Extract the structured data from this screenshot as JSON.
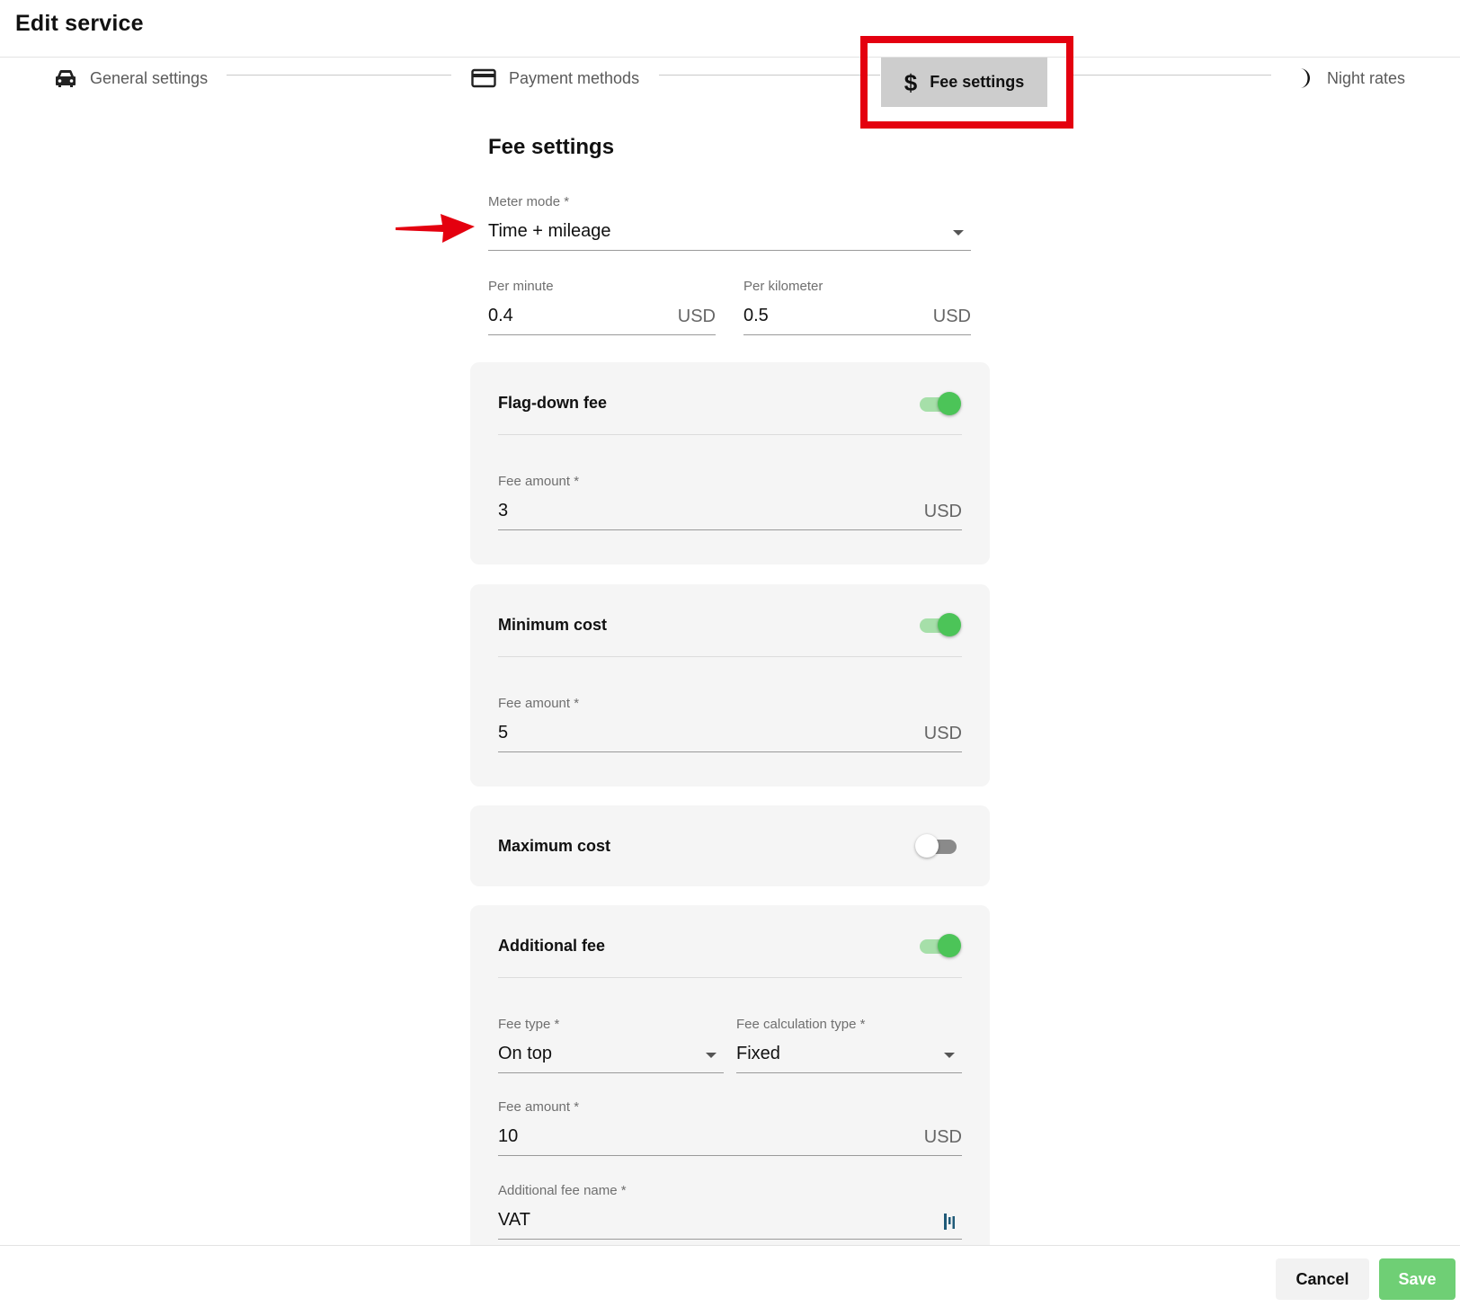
{
  "header": {
    "title": "Edit service"
  },
  "stepper": {
    "steps": [
      {
        "label": "General settings",
        "icon": "car-icon"
      },
      {
        "label": "Payment methods",
        "icon": "credit-card-icon"
      },
      {
        "label": "Fee settings",
        "icon": "dollar-icon",
        "active": true
      },
      {
        "label": "Night rates",
        "icon": "moon-icon"
      }
    ]
  },
  "section": {
    "title": "Fee settings"
  },
  "meter_mode": {
    "label": "Meter mode *",
    "value": "Time + mileage"
  },
  "per_minute": {
    "label": "Per minute",
    "value": "0.4",
    "unit": "USD"
  },
  "per_kilometer": {
    "label": "Per kilometer",
    "value": "0.5",
    "unit": "USD"
  },
  "flag_down": {
    "title": "Flag-down fee",
    "enabled": true,
    "amount_label": "Fee amount *",
    "amount": "3",
    "unit": "USD"
  },
  "minimum_cost": {
    "title": "Minimum cost",
    "enabled": true,
    "amount_label": "Fee amount *",
    "amount": "5",
    "unit": "USD"
  },
  "maximum_cost": {
    "title": "Maximum cost",
    "enabled": false
  },
  "additional_fee": {
    "title": "Additional fee",
    "enabled": true,
    "fee_type_label": "Fee type *",
    "fee_type": "On top",
    "calc_type_label": "Fee calculation type *",
    "calc_type": "Fixed",
    "amount_label": "Fee amount *",
    "amount": "10",
    "unit": "USD",
    "name_label": "Additional fee name *",
    "name": "VAT"
  },
  "footer": {
    "cancel_label": "Cancel",
    "save_label": "Save"
  },
  "colors": {
    "accent_green": "#4cc458",
    "highlight_red": "#e4000f",
    "save_button": "#6fcf75"
  }
}
